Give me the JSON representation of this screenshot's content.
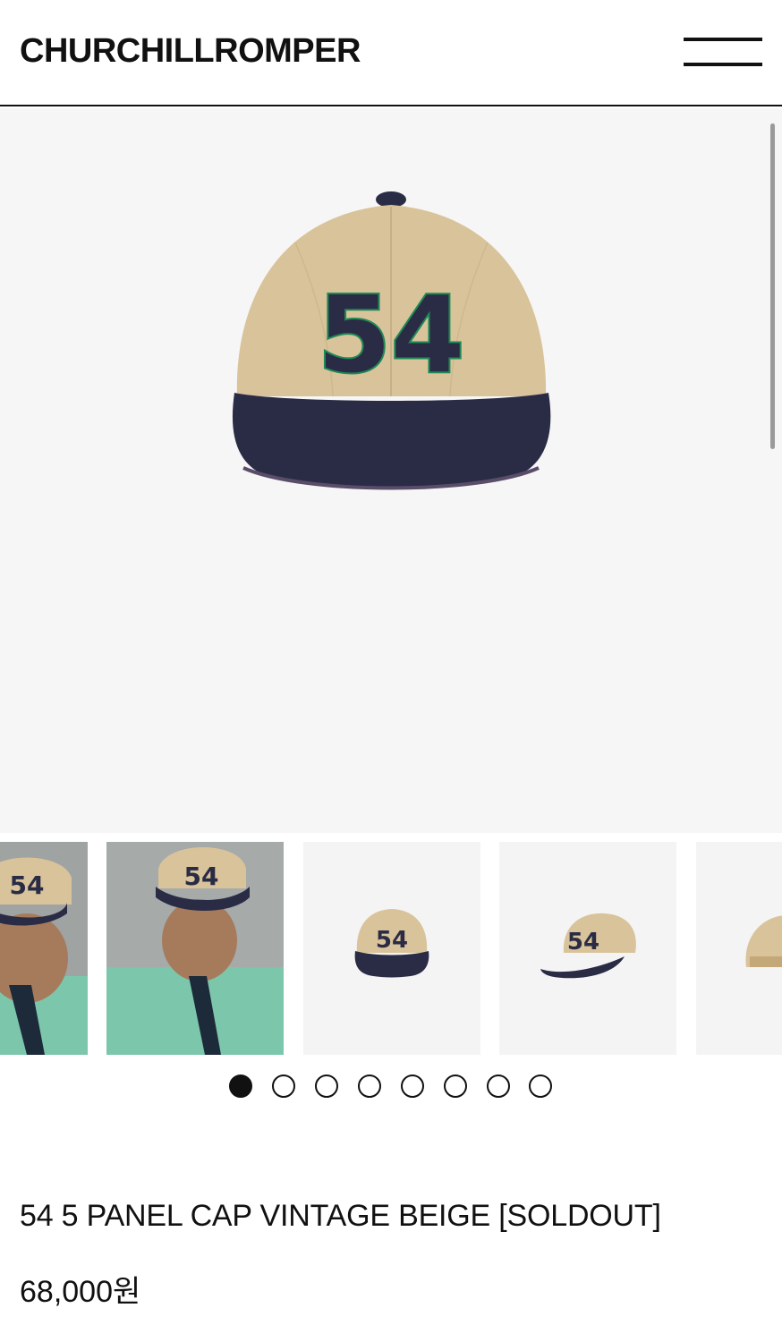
{
  "header": {
    "brand": "CHURCHILLROMPER",
    "menu_icon": "hamburger-menu-icon"
  },
  "gallery": {
    "current_index": 0,
    "total_slides": 8,
    "hero_cap_number": "54",
    "thumbnails": [
      {
        "kind": "model-front-cropped",
        "cap_number": "54"
      },
      {
        "kind": "model-front",
        "cap_number": "54"
      },
      {
        "kind": "cap-front",
        "cap_number": "54"
      },
      {
        "kind": "cap-side",
        "cap_number": "54"
      },
      {
        "kind": "cap-back-partial",
        "cap_number": ""
      }
    ]
  },
  "product": {
    "title": "54 5 PANEL CAP VINTAGE BEIGE [SOLDOUT]",
    "price": "68,000원"
  },
  "colors": {
    "cap_beige": "#d9c39a",
    "cap_navy": "#2a2c46",
    "stitch_green": "#1f8a55",
    "shirt_mint": "#7cc6ac"
  }
}
